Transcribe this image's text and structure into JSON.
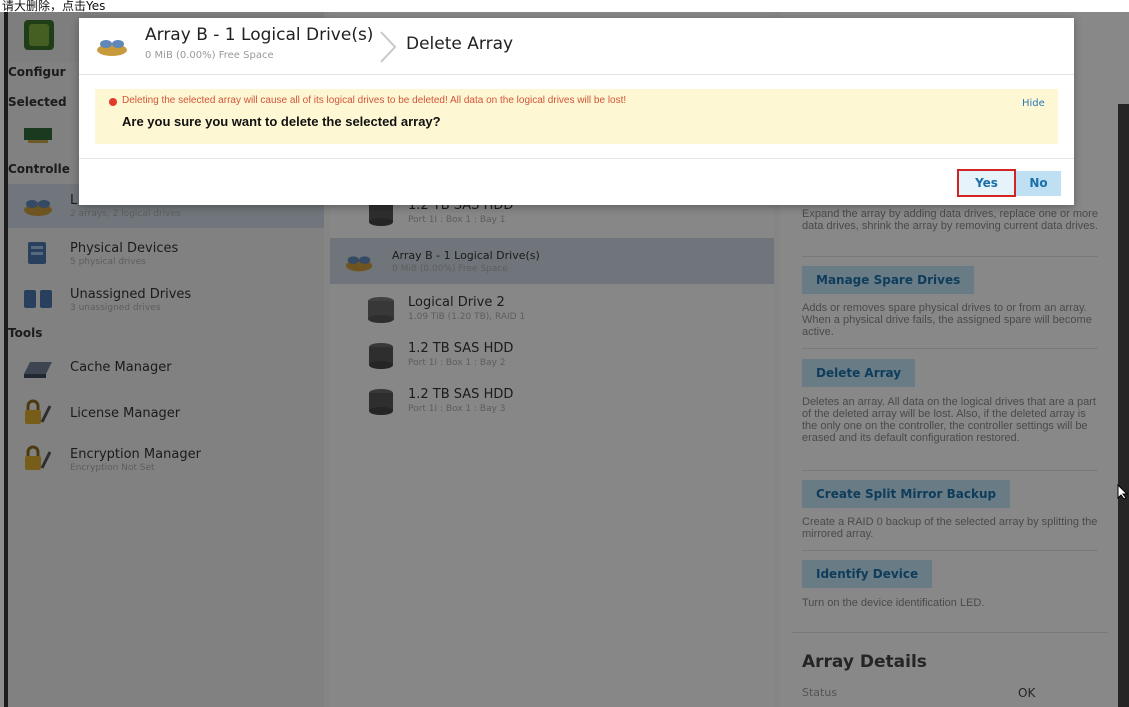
{
  "caption": "请大删除，点击Yes",
  "header": {
    "section_configure": "Configur",
    "section_selected": "Selected",
    "section_controller": "Controlle"
  },
  "sidebar": {
    "items": [
      {
        "title": "L",
        "subtitle": "2 arrays, 2 logical drives",
        "icon": "logical-devices-icon"
      },
      {
        "title": "Physical Devices",
        "subtitle": "5 physical drives",
        "icon": "physical-devices-icon"
      },
      {
        "title": "Unassigned Drives",
        "subtitle": "3 unassigned drives",
        "icon": "unassigned-drives-icon"
      }
    ],
    "tools_label": "Tools",
    "tools": [
      {
        "title": "Cache Manager",
        "icon": "cache-manager-icon"
      },
      {
        "title": "License Manager",
        "icon": "license-manager-icon"
      },
      {
        "title": "Encryption Manager",
        "subtitle": "Encryption Not Set",
        "icon": "encryption-manager-icon"
      }
    ]
  },
  "center": {
    "items": [
      {
        "title": "1.2 TB SAS HDD",
        "subtitle": "Port 1I : Box 1 : Bay 1",
        "icon": "hdd-icon"
      },
      {
        "title": "Array B - 1 Logical Drive(s)",
        "subtitle": "0 MiB (0.00%) Free Space",
        "icon": "array-icon",
        "selected": true
      },
      {
        "title": "Logical Drive 2",
        "subtitle": "1.09 TiB (1.20 TB), RAID 1",
        "icon": "logical-drive-icon"
      },
      {
        "title": "1.2 TB SAS HDD",
        "subtitle": "Port 1I : Box 1 : Bay 2",
        "icon": "hdd-icon"
      },
      {
        "title": "1.2 TB SAS HDD",
        "subtitle": "Port 1I : Box 1 : Bay 3",
        "icon": "hdd-icon"
      }
    ]
  },
  "right": {
    "expand_desc": "Expand the array by adding data drives, replace one or more data drives, shrink the array by removing current data drives.",
    "actions": [
      {
        "label": "Manage Spare Drives",
        "desc": "Adds or removes spare physical drives to or from an array. When a physical drive fails, the assigned spare will become active."
      },
      {
        "label": "Delete Array",
        "desc": "Deletes an array. All data on the logical drives that are a part of the deleted array will be lost. Also, if the deleted array is the only one on the controller, the controller settings will be erased and its default configuration restored."
      },
      {
        "label": "Create Split Mirror Backup",
        "desc": "Create a RAID 0 backup of the selected array by splitting the mirrored array."
      },
      {
        "label": "Identify Device",
        "desc": "Turn on the device identification LED."
      }
    ],
    "details_title": "Array Details",
    "status_label": "Status",
    "status_value": "OK"
  },
  "modal": {
    "title": "Array B - 1 Logical Drive(s)",
    "subtitle": "0 MiB (0.00%) Free Space",
    "breadcrumb": "Delete Array",
    "warning": "Deleting the selected array will cause all of its logical drives to be deleted! All data on the logical drives will be lost!",
    "question": "Are you sure you want to delete the selected array?",
    "hide_label": "Hide",
    "yes_label": "Yes",
    "no_label": "No",
    "close_glyph": "✕"
  },
  "colors": {
    "accent": "#1b6fa8",
    "button_bg": "#bfe0f2",
    "warning_bg": "#fdf7d3",
    "warning_text": "#d4553a",
    "highlight_border": "#d32424"
  }
}
